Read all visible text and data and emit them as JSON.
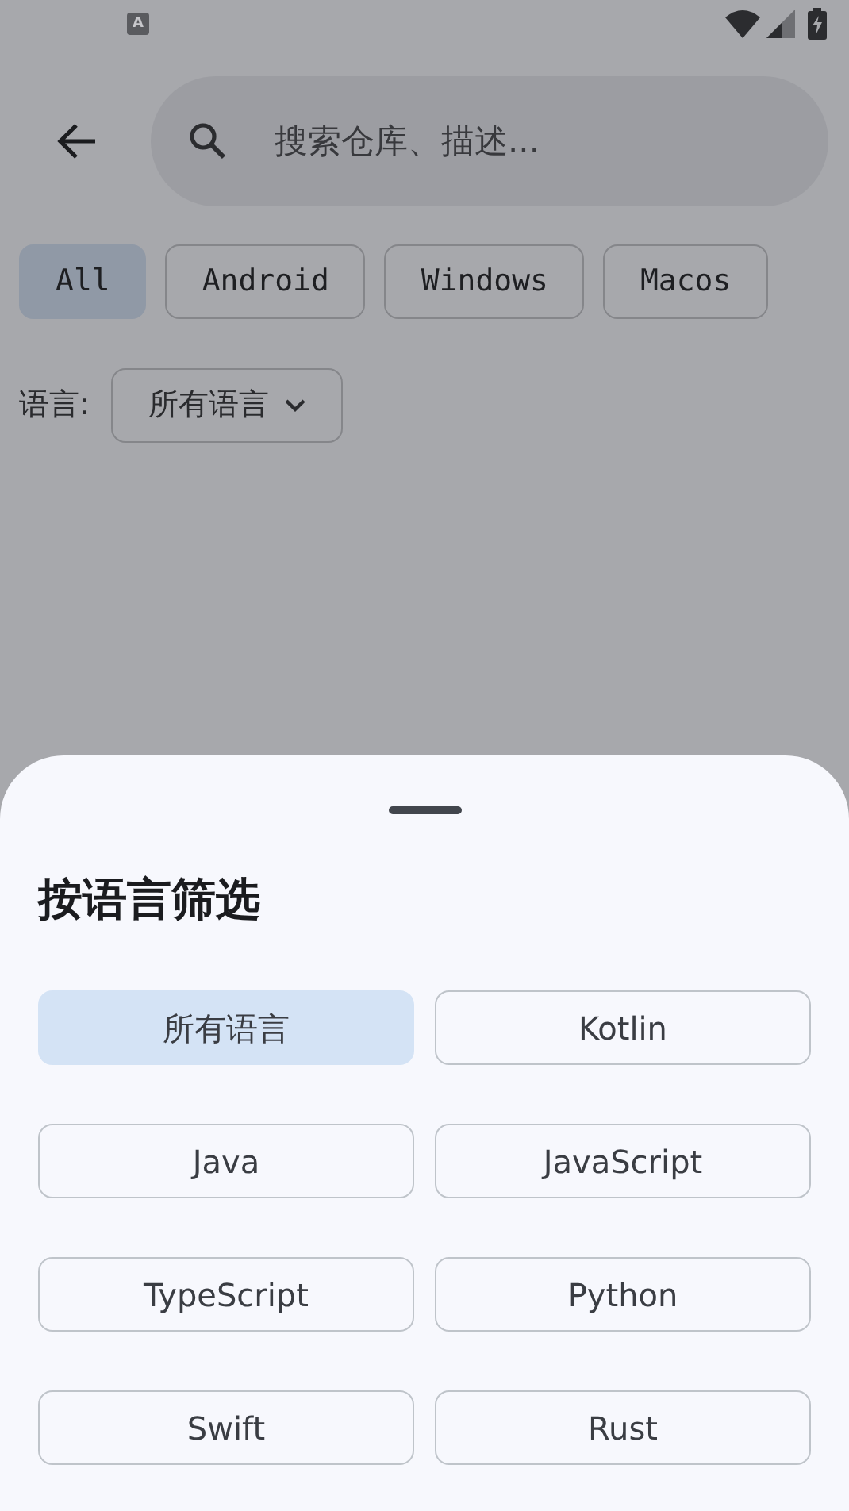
{
  "status_bar": {
    "notification_icon": "A"
  },
  "search": {
    "placeholder": "搜索仓库、描述..."
  },
  "platform_chips": [
    {
      "label": "All",
      "selected": true
    },
    {
      "label": "Android",
      "selected": false
    },
    {
      "label": "Windows",
      "selected": false
    },
    {
      "label": "Macos",
      "selected": false
    }
  ],
  "language_filter": {
    "label": "语言:",
    "value": "所有语言"
  },
  "sheet": {
    "title": "按语言筛选",
    "options": [
      {
        "label": "所有语言",
        "selected": true
      },
      {
        "label": "Kotlin",
        "selected": false
      },
      {
        "label": "Java",
        "selected": false
      },
      {
        "label": "JavaScript",
        "selected": false
      },
      {
        "label": "TypeScript",
        "selected": false
      },
      {
        "label": "Python",
        "selected": false
      },
      {
        "label": "Swift",
        "selected": false
      },
      {
        "label": "Rust",
        "selected": false
      }
    ]
  }
}
